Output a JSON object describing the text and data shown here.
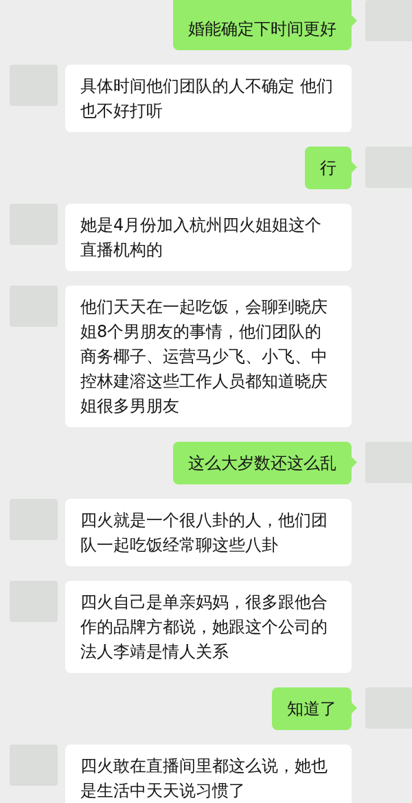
{
  "messages": [
    {
      "kind": "sent",
      "text": "婚能确定下时间更好"
    },
    {
      "kind": "received",
      "text": "具体时间他们团队的人不确定 他们也不好打听"
    },
    {
      "kind": "sent",
      "text": "行"
    },
    {
      "kind": "received",
      "text": "她是4月份加入杭州四火姐姐这个直播机构的"
    },
    {
      "kind": "received",
      "text": "他们天天在一起吃饭，会聊到晓庆姐8个男朋友的事情，他们团队的商务椰子、运营马少飞、小飞、中控林建溶这些工作人员都知道晓庆姐很多男朋友"
    },
    {
      "kind": "sent",
      "text": "这么大岁数还这么乱"
    },
    {
      "kind": "received",
      "text": "四火就是一个很八卦的人，他们团队一起吃饭经常聊这些八卦"
    },
    {
      "kind": "received",
      "text": "四火自己是单亲妈妈，很多跟他合作的品牌方都说，她跟这个公司的法人李靖是情人关系"
    },
    {
      "kind": "sent",
      "text": "知道了"
    },
    {
      "kind": "received",
      "text": "四火敢在直播间里都这么说，她也是生活中天天说习惯了"
    }
  ]
}
